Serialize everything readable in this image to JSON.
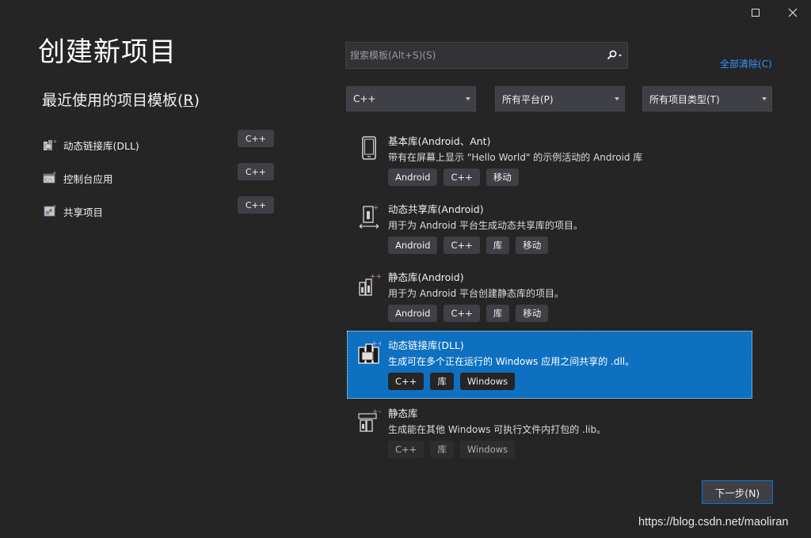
{
  "window": {
    "maximize_icon": "maximize-icon",
    "close_icon": "close-icon"
  },
  "title": "创建新项目",
  "recent": {
    "heading": "最近使用的项目模板(",
    "heading_key": "R",
    "heading_suffix": ")",
    "items": [
      {
        "label": "动态链接库(DLL)",
        "tag": "C++",
        "icon": "dll-library-icon"
      },
      {
        "label": "控制台应用",
        "tag": "C++",
        "icon": "console-app-icon"
      },
      {
        "label": "共享项目",
        "tag": "C++",
        "icon": "shared-project-icon"
      }
    ]
  },
  "search": {
    "placeholder": "搜索模板(Alt+S)(S)",
    "icon": "search-icon"
  },
  "clear_all": "全部清除(C)",
  "filters": {
    "language": "C++",
    "platform": "所有平台(P)",
    "project_type": "所有项目类型(T)"
  },
  "templates": [
    {
      "name": "基本库(Android、Ant)",
      "desc": "带有在屏幕上显示 \"Hello World\" 的示例活动的 Android 库",
      "tags": [
        "Android",
        "C++",
        "移动"
      ],
      "icon": "phone-icon"
    },
    {
      "name": "动态共享库(Android)",
      "desc": "用于为 Android 平台生成动态共享库的项目。",
      "tags": [
        "Android",
        "C++",
        "库",
        "移动"
      ],
      "icon": "shared-library-icon"
    },
    {
      "name": "静态库(Android)",
      "desc": "用于为 Android 平台创建静态库的项目。",
      "tags": [
        "Android",
        "C++",
        "库",
        "移动"
      ],
      "icon": "static-library-icon"
    },
    {
      "name": "动态链接库(DLL)",
      "desc": "生成可在多个正在运行的 Windows 应用之间共享的 .dll。",
      "tags": [
        "C++",
        "库",
        "Windows"
      ],
      "icon": "dll-icon",
      "selected": true
    },
    {
      "name": "静态库",
      "desc": "生成能在其他 Windows 可执行文件内打包的 .lib。",
      "tags": [
        "C++",
        "库",
        "Windows"
      ],
      "icon": "static-lib-icon"
    }
  ],
  "next_button": "下一步(N)",
  "watermark": "https://blog.csdn.net/maoliran",
  "colors": {
    "background": "#252526",
    "accent": "#0e70c0",
    "link": "#3794ff",
    "tag_bg": "#3f3f46"
  }
}
